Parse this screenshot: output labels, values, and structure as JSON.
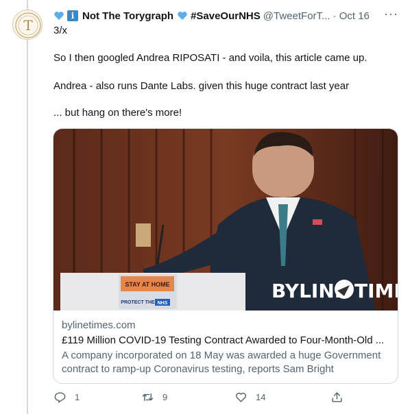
{
  "tweet": {
    "display_name": "Not The Torygraph",
    "hashtag": "#SaveOurNHS",
    "handle": "@TweetForT...",
    "date": "· Oct 16",
    "more": "···",
    "lines": [
      "3/x",
      "So I then googled Andrea RIPOSATI - and voila, this article came up.",
      "Andrea - also runs Dante Labs. given this huge contract last year",
      "... but hang on there's more!"
    ]
  },
  "card": {
    "domain": "bylinetimes.com",
    "title": "£119 Million COVID-19 Testing Contract Awarded to Four-Month-Old ...",
    "description": "A company incorporated on 18 May was awarded a huge Government contract to ramp-up Coronavirus testing, reports Sam Bright",
    "image": {
      "lectern_top": "STAY AT HOME",
      "lectern_bottom": "PROTECT THE",
      "nhs": "NHS",
      "brand_left": "BYLINE",
      "brand_right": "TIMES"
    }
  },
  "actions": {
    "replies": "1",
    "retweets": "9",
    "likes": "14"
  },
  "colors": {
    "accent": "#1d9bf0",
    "text_secondary": "#536471",
    "border": "#cfd9de"
  }
}
